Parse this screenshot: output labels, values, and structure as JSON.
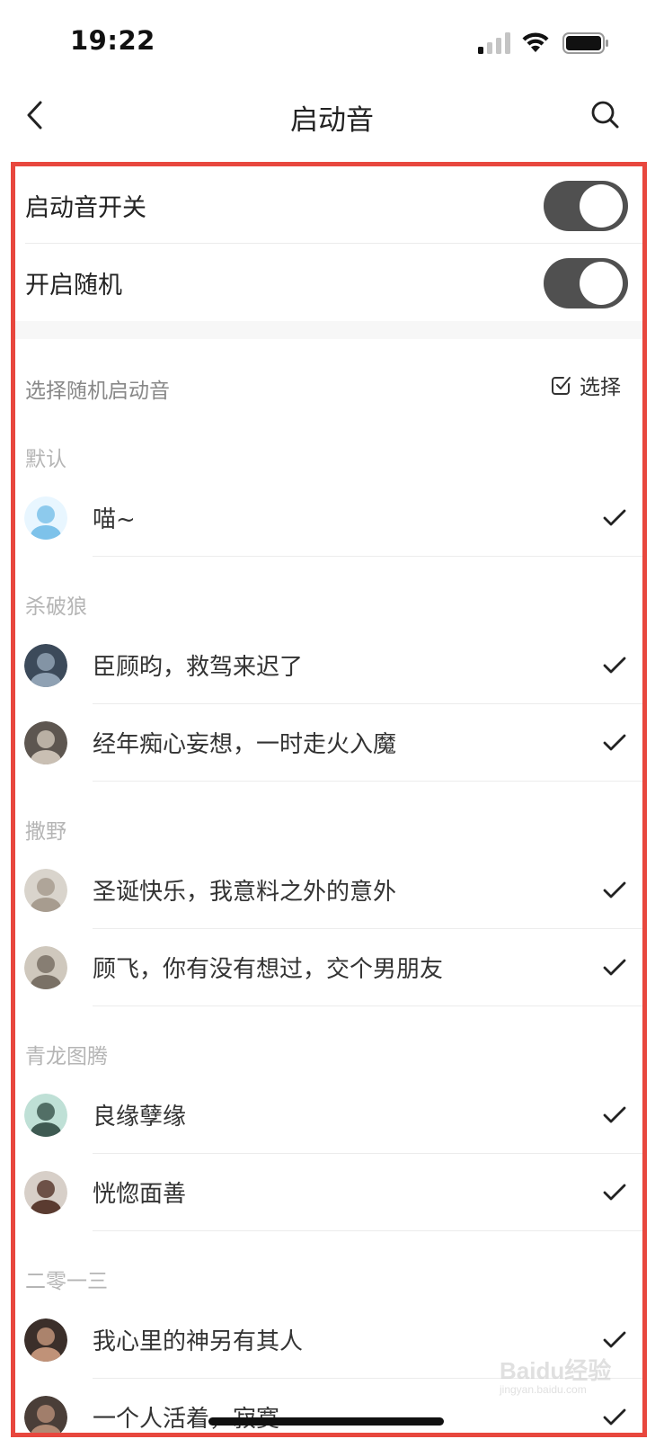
{
  "status_bar": {
    "time": "19:22"
  },
  "nav": {
    "title": "启动音"
  },
  "toggles": [
    {
      "label": "启动音开关",
      "on": true
    },
    {
      "label": "开启随机",
      "on": true
    }
  ],
  "random_section": {
    "hint": "选择随机启动音",
    "select_label": "选择"
  },
  "groups": [
    {
      "name": "默认",
      "items": [
        {
          "title": "喵~",
          "selected": true,
          "avatar_colors": [
            "#e8f6ff",
            "#7dc2ea"
          ]
        }
      ]
    },
    {
      "name": "杀破狼",
      "items": [
        {
          "title": "臣顾昀，救驾来迟了",
          "selected": true,
          "avatar_colors": [
            "#3c4a5a",
            "#8fa1b3"
          ]
        },
        {
          "title": "经年痴心妄想，一时走火入魔",
          "selected": true,
          "avatar_colors": [
            "#5d5650",
            "#c9bfb3"
          ]
        }
      ]
    },
    {
      "name": "撒野",
      "items": [
        {
          "title": "圣诞快乐，我意料之外的意外",
          "selected": true,
          "avatar_colors": [
            "#d9d4cc",
            "#a79c8f"
          ]
        },
        {
          "title": "顾飞，你有没有想过，交个男朋友",
          "selected": true,
          "avatar_colors": [
            "#cfc8bd",
            "#7a7166"
          ]
        }
      ]
    },
    {
      "name": "青龙图腾",
      "items": [
        {
          "title": "良缘孽缘",
          "selected": true,
          "avatar_colors": [
            "#bfe0d6",
            "#3e5a52"
          ]
        },
        {
          "title": "恍惚面善",
          "selected": true,
          "avatar_colors": [
            "#d7cfc8",
            "#5a3b30"
          ]
        }
      ]
    },
    {
      "name": "二零一三",
      "items": [
        {
          "title": "我心里的神另有其人",
          "selected": true,
          "avatar_colors": [
            "#3b2f2a",
            "#c09278"
          ]
        },
        {
          "title": "一个人活着，寂寞",
          "selected": true,
          "avatar_colors": [
            "#4a3e38",
            "#b08a74"
          ]
        }
      ]
    }
  ],
  "watermark": {
    "text": "Baidu经验",
    "sub": "jingyan.baidu.com"
  },
  "colors": {
    "highlight": "#e8473e",
    "switch_on": "#505050",
    "group_header": "#b5b5b5"
  }
}
